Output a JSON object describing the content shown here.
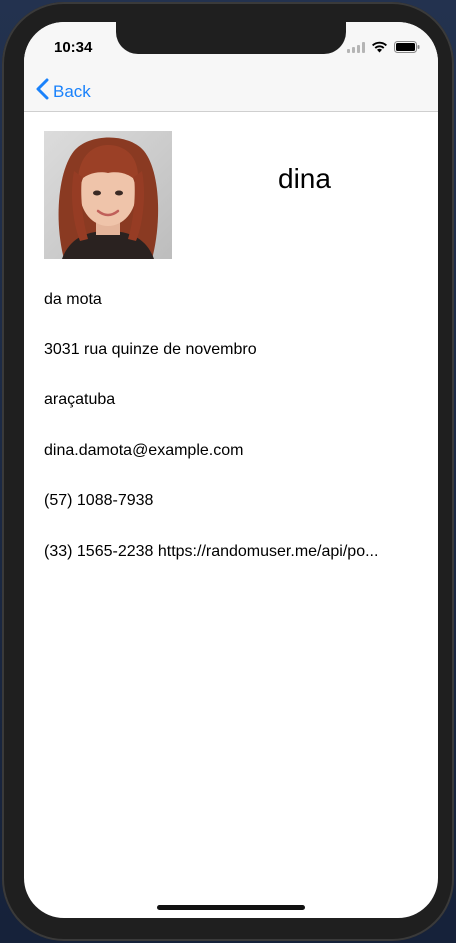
{
  "status_bar": {
    "time": "10:34",
    "signal_icon": "cellular-signal-icon",
    "wifi_icon": "wifi-icon",
    "battery_icon": "battery-icon"
  },
  "nav": {
    "back_label": "Back",
    "back_icon": "chevron-left-icon",
    "accent_color": "#1a82fb"
  },
  "profile": {
    "photo_icon": "profile-photo",
    "first_name": "dina",
    "fields": [
      "da mota",
      "3031 rua quinze de novembro",
      "araçatuba",
      "dina.damota@example.com",
      "(57) 1088-7938",
      "(33) 1565-2238 https://randomuser.me/api/po..."
    ]
  }
}
